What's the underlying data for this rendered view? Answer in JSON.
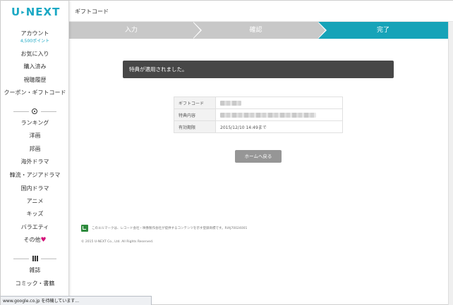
{
  "brand": {
    "logo_left": "U",
    "logo_arrow": "▸",
    "logo_right": "NEXT"
  },
  "header": {
    "title": "ギフトコード"
  },
  "steps": [
    {
      "label": "入力",
      "state": "done"
    },
    {
      "label": "確認",
      "state": "done"
    },
    {
      "label": "完了",
      "state": "active"
    }
  ],
  "sidebar": {
    "account": "アカウント",
    "points": "4,500ポイント",
    "items_top": [
      "お気に入り",
      "購入済み",
      "視聴履歴",
      "クーポン・ギフトコード"
    ],
    "items_video": [
      "ランキング",
      "洋画",
      "邦画",
      "海外ドラマ",
      "韓流・アジアドラマ",
      "国内ドラマ",
      "アニメ",
      "キッズ",
      "バラエティ",
      "その他"
    ],
    "heart": "♥",
    "items_books": [
      "雑誌",
      "コミック・書籍"
    ],
    "divider_icons": [
      "clock-icon",
      "books-icon"
    ]
  },
  "alert": {
    "message": "特典が適用されました。"
  },
  "table": {
    "rows": [
      {
        "label": "ギフトコード",
        "value": "",
        "redacted": true
      },
      {
        "label": "特典内容",
        "value": "",
        "redacted": true
      },
      {
        "label": "有効期限",
        "value": "2015/12/10 14:49まで",
        "redacted": false
      }
    ]
  },
  "home_button": {
    "label": "ホームへ戻る"
  },
  "footer": {
    "lmark_note": "このエルマークは、レコード会社・映像製作会社が提供するコンテンツを示す登録商標です。RIAJ70024001",
    "copyright": "© 2015 U-NEXT Co., Ltd. All Rights Reserved."
  },
  "status_bar": {
    "text": "www.google.co.jp を待機しています..."
  },
  "colors": {
    "accent": "#16a3b8",
    "step_inactive": "#c8c8c8",
    "alert_bg": "#474747",
    "heart": "#d4137a"
  }
}
